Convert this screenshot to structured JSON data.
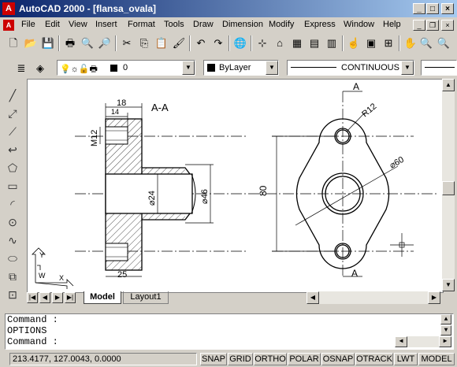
{
  "app": {
    "title": "AutoCAD 2000 - [flansa_ovala]",
    "logo": "A"
  },
  "menu": [
    "File",
    "Edit",
    "View",
    "Insert",
    "Format",
    "Tools",
    "Draw",
    "Dimension",
    "Modify",
    "Express",
    "Window",
    "Help"
  ],
  "layer": {
    "name": "0"
  },
  "color": {
    "value": "ByLayer"
  },
  "linetype": {
    "value": "CONTINUOUS"
  },
  "drawing": {
    "section_label": "A-A",
    "dims": {
      "d18": "18",
      "d14": "14",
      "m12": "M12",
      "d24": "⌀24",
      "d46": "⌀46",
      "d25": "25",
      "d80": "80",
      "r12": "R12",
      "d60": "⌀60",
      "a_top": "A",
      "a_bottom": "A"
    },
    "ucs": {
      "y": "Y",
      "w": "W",
      "x": "X"
    }
  },
  "tabs": {
    "model": "Model",
    "layout1": "Layout1"
  },
  "command": {
    "line1": "Command :",
    "line2": "OPTIONS",
    "line3": "Command :"
  },
  "status": {
    "coords": "213.4177, 127.0043, 0.0000",
    "snap": "SNAP",
    "grid": "GRID",
    "ortho": "ORTHO",
    "polar": "POLAR",
    "osnap": "OSNAP",
    "otrack": "OTRACK",
    "lwt": "LWT",
    "model": "MODEL"
  }
}
